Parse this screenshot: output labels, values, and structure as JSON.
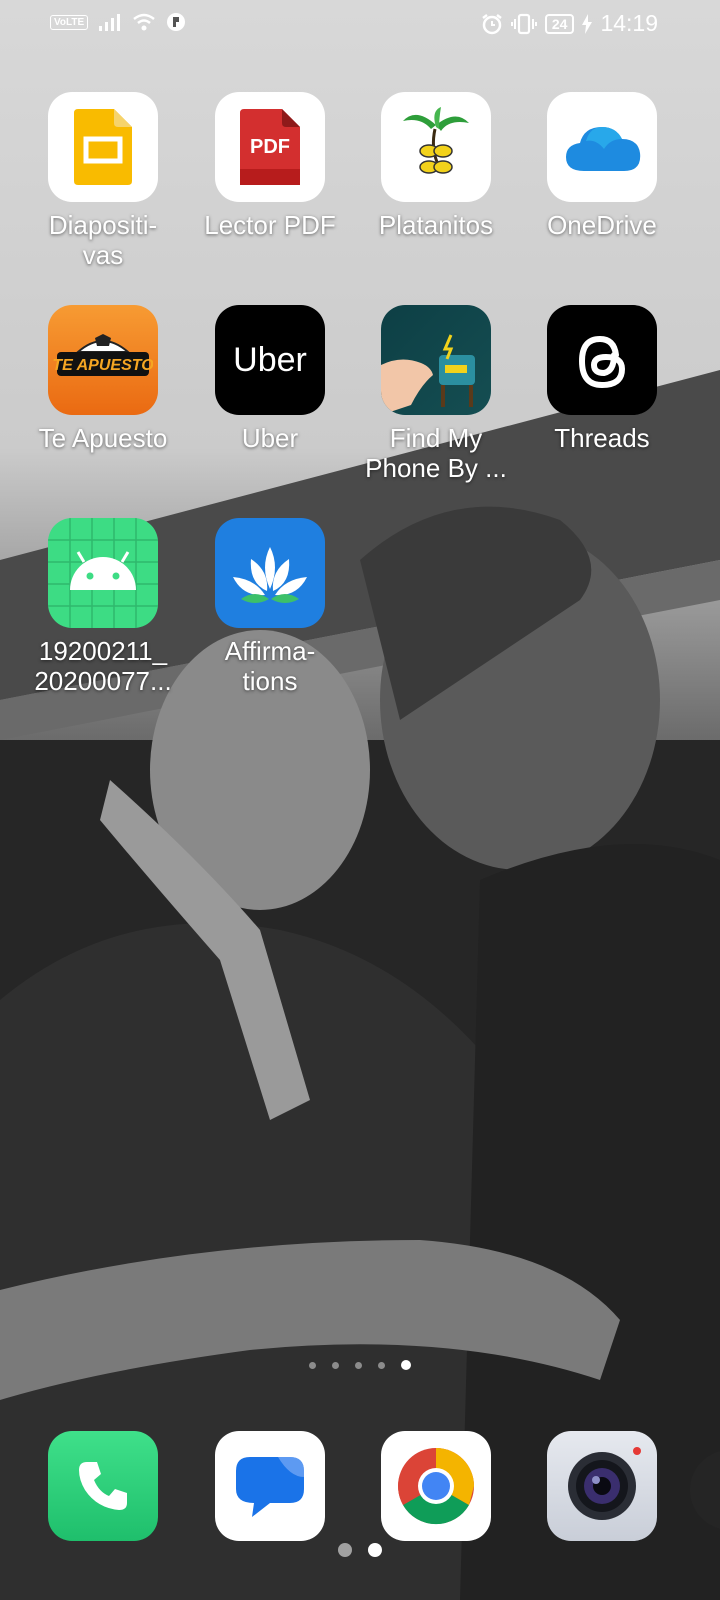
{
  "status_bar": {
    "network": "VoLTE",
    "battery": "24",
    "time": "14:19"
  },
  "home": {
    "apps": [
      {
        "label": "Diapositi-\nvas",
        "icon": "google-slides-icon"
      },
      {
        "label": "Lector PDF",
        "icon": "pdf-reader-icon",
        "icon_text": "PDF"
      },
      {
        "label": "Platanitos",
        "icon": "platanitos-icon"
      },
      {
        "label": "OneDrive",
        "icon": "onedrive-icon"
      },
      {
        "label": "Te Apuesto",
        "icon": "te-apuesto-icon",
        "icon_text": "TE APUESTO"
      },
      {
        "label": "Uber",
        "icon": "uber-icon",
        "icon_text": "Uber"
      },
      {
        "label": "Find My\nPhone By ...",
        "icon": "find-my-phone-icon"
      },
      {
        "label": "Threads",
        "icon": "threads-icon"
      },
      {
        "label": "19200211_\n20200077...",
        "icon": "android-apk-icon"
      },
      {
        "label": "Affirma-\ntions",
        "icon": "affirmations-icon"
      }
    ],
    "page_indicator": {
      "count": 5,
      "active": 5
    }
  },
  "dock": {
    "apps": [
      {
        "name": "Phone",
        "icon": "phone-icon"
      },
      {
        "name": "Messages",
        "icon": "messages-icon"
      },
      {
        "name": "Chrome",
        "icon": "chrome-icon"
      },
      {
        "name": "Camera",
        "icon": "camera-icon"
      }
    ],
    "indicator": {
      "count": 2,
      "active": 2
    }
  },
  "colors": {
    "slides": "#F9BB00",
    "pdf": "#D32F2F",
    "onedrive": "#1E8BE0",
    "te_apuesto": "#F07A1C",
    "uber": "#000000",
    "threads": "#000000",
    "android_green": "#3DDC84",
    "affirmations": "#1F7FE0",
    "phone_green": "#2ECC71"
  }
}
